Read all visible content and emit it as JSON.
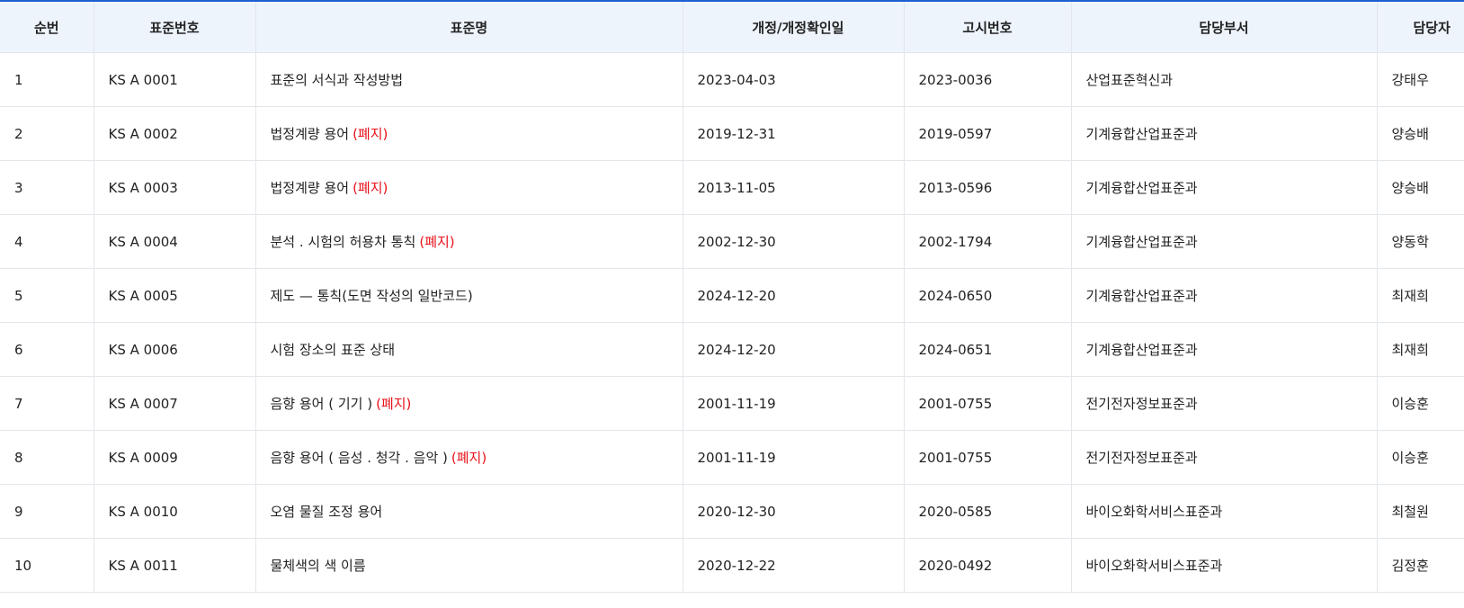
{
  "table": {
    "headers": {
      "no": "순번",
      "code": "표준번호",
      "name": "표준명",
      "date": "개정/개정확인일",
      "notice": "고시번호",
      "dept": "담당부서",
      "person": "담당자"
    },
    "withdrawn_label": "(폐지)",
    "colors": {
      "header_bg": "#eef4fc",
      "top_border": "#1f5fd1",
      "withdrawn": "#e8101a"
    },
    "rows": [
      {
        "no": "1",
        "code": "KS A 0001",
        "name": "표준의 서식과 작성방법",
        "withdrawn": false,
        "date": "2023-04-03",
        "notice": "2023-0036",
        "dept": "산업표준혁신과",
        "person": "강태우"
      },
      {
        "no": "2",
        "code": "KS A 0002",
        "name": "법정계량 용어",
        "withdrawn": true,
        "date": "2019-12-31",
        "notice": "2019-0597",
        "dept": "기계융합산업표준과",
        "person": "양승배"
      },
      {
        "no": "3",
        "code": "KS A 0003",
        "name": "법정계량 용어",
        "withdrawn": true,
        "date": "2013-11-05",
        "notice": "2013-0596",
        "dept": "기계융합산업표준과",
        "person": "양승배"
      },
      {
        "no": "4",
        "code": "KS A 0004",
        "name": "분석 . 시험의 허용차 통칙",
        "withdrawn": true,
        "date": "2002-12-30",
        "notice": "2002-1794",
        "dept": "기계융합산업표준과",
        "person": "양동학"
      },
      {
        "no": "5",
        "code": "KS A 0005",
        "name": "제도 — 통칙(도면 작성의 일반코드)",
        "withdrawn": false,
        "date": "2024-12-20",
        "notice": "2024-0650",
        "dept": "기계융합산업표준과",
        "person": "최재희"
      },
      {
        "no": "6",
        "code": "KS A 0006",
        "name": "시험 장소의 표준 상태",
        "withdrawn": false,
        "date": "2024-12-20",
        "notice": "2024-0651",
        "dept": "기계융합산업표준과",
        "person": "최재희"
      },
      {
        "no": "7",
        "code": "KS A 0007",
        "name": "음향 용어 ( 기기 )",
        "withdrawn": true,
        "date": "2001-11-19",
        "notice": "2001-0755",
        "dept": "전기전자정보표준과",
        "person": "이승훈"
      },
      {
        "no": "8",
        "code": "KS A 0009",
        "name": "음향 용어 ( 음성 . 청각 . 음악 )",
        "withdrawn": true,
        "date": "2001-11-19",
        "notice": "2001-0755",
        "dept": "전기전자정보표준과",
        "person": "이승훈"
      },
      {
        "no": "9",
        "code": "KS A 0010",
        "name": "오염 물질 조정 용어",
        "withdrawn": false,
        "date": "2020-12-30",
        "notice": "2020-0585",
        "dept": "바이오화학서비스표준과",
        "person": "최철원"
      },
      {
        "no": "10",
        "code": "KS A 0011",
        "name": "물체색의 색 이름",
        "withdrawn": false,
        "date": "2020-12-22",
        "notice": "2020-0492",
        "dept": "바이오화학서비스표준과",
        "person": "김정훈"
      }
    ]
  }
}
